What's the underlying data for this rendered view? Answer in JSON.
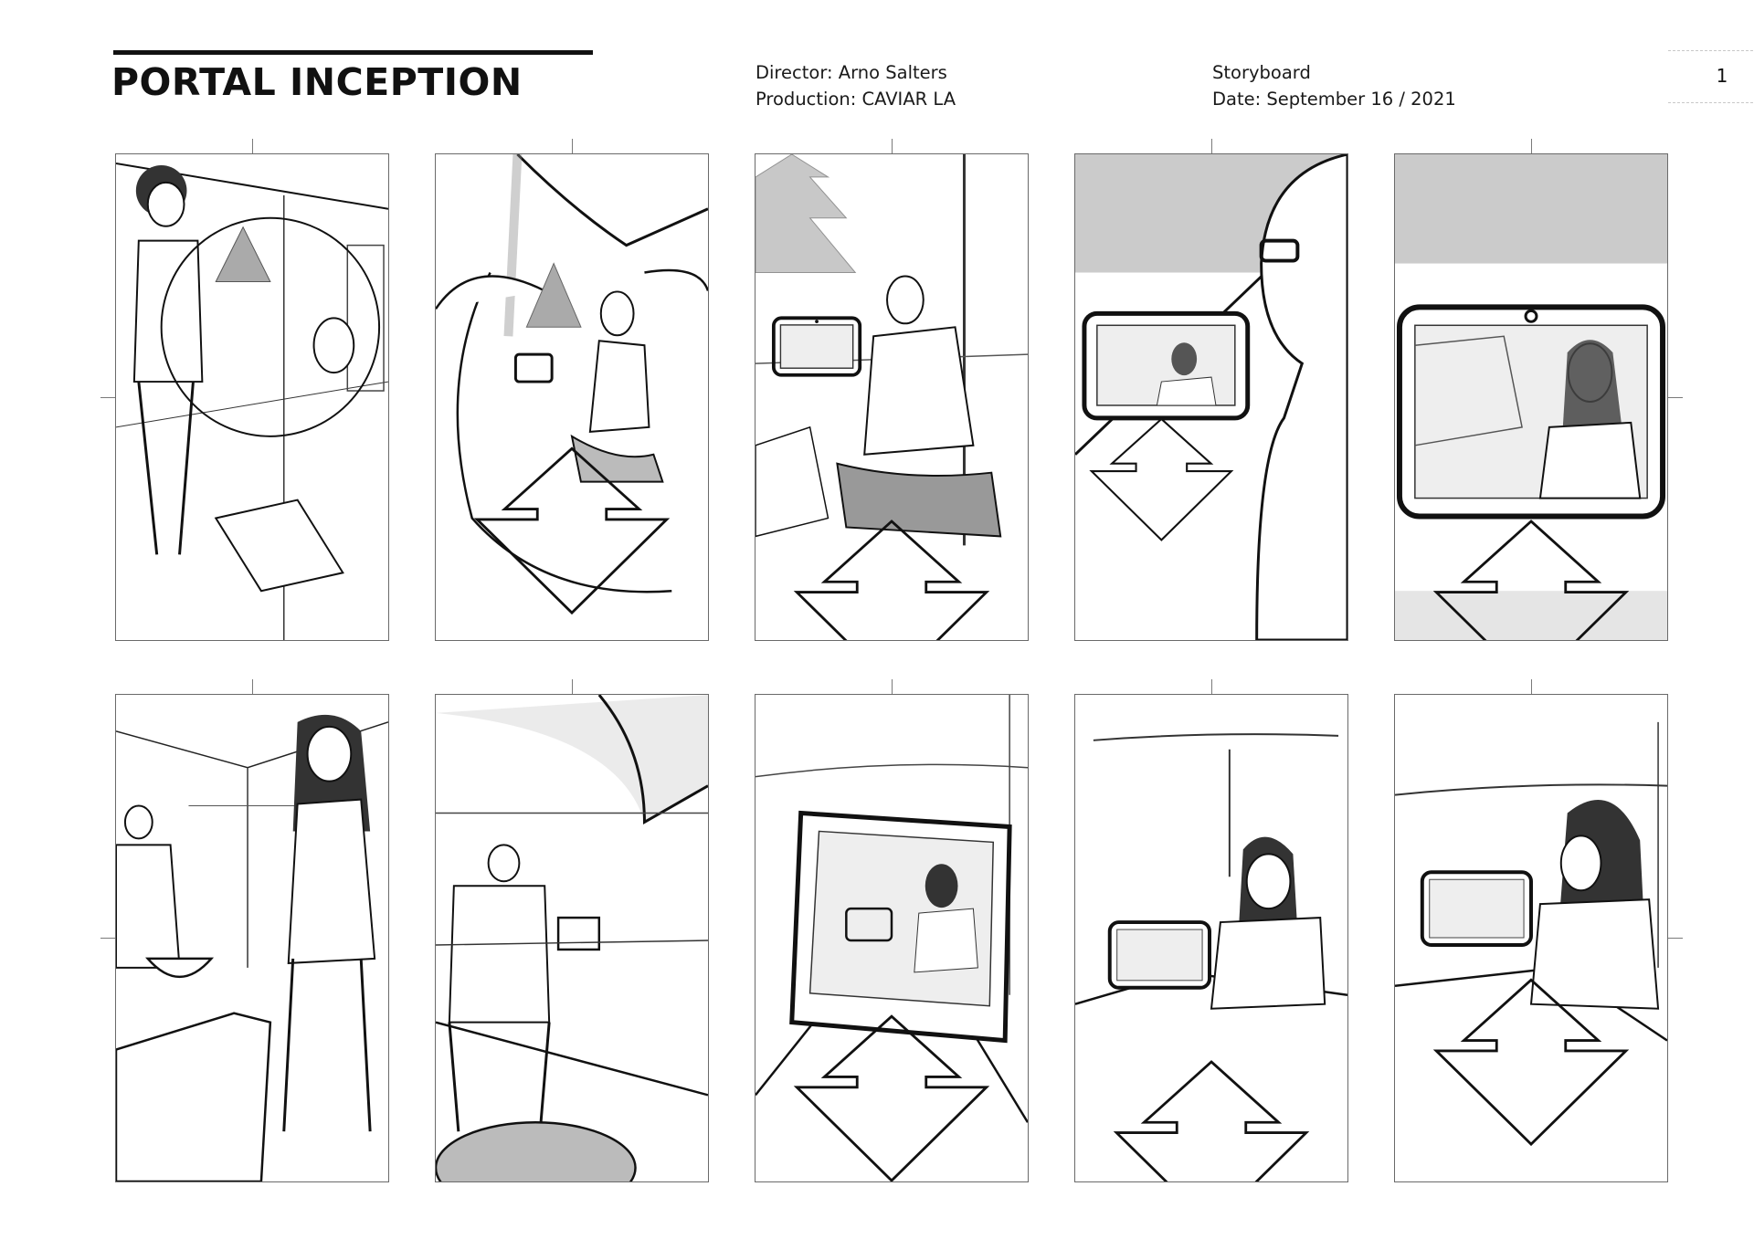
{
  "header": {
    "title": "PORTAL INCEPTION",
    "director": "Director: Arno Salters",
    "production": "Production: CAVIAR LA",
    "doc_type": "Storyboard",
    "date": "Date: September 16 / 2021",
    "page_number": "1"
  },
  "colors": {
    "ink": "#111111",
    "frame_border": "#6a6a6a",
    "shade": "#a8a8a8"
  },
  "panels": [
    {
      "id": 1,
      "row": 1,
      "col": 1,
      "scene": "child-with-lights",
      "has_arrow": false
    },
    {
      "id": 2,
      "row": 1,
      "col": 2,
      "scene": "hands-with-lights",
      "has_arrow": true
    },
    {
      "id": 3,
      "row": 1,
      "col": 3,
      "scene": "man-kneeling-portal",
      "has_arrow": true
    },
    {
      "id": 4,
      "row": 1,
      "col": 4,
      "scene": "over-shoulder-portal",
      "has_arrow": true
    },
    {
      "id": 5,
      "row": 1,
      "col": 5,
      "scene": "portal-closeup",
      "has_arrow": true
    },
    {
      "id": 6,
      "row": 2,
      "col": 1,
      "scene": "woman-kitchen",
      "has_arrow": false
    },
    {
      "id": 7,
      "row": 2,
      "col": 2,
      "scene": "man-kitchen-plates",
      "has_arrow": false
    },
    {
      "id": 8,
      "row": 2,
      "col": 3,
      "scene": "portal-on-table",
      "has_arrow": true
    },
    {
      "id": 9,
      "row": 2,
      "col": 4,
      "scene": "woman-at-table-portal",
      "has_arrow": true
    },
    {
      "id": 10,
      "row": 2,
      "col": 5,
      "scene": "woman-side-portal",
      "has_arrow": true
    }
  ]
}
